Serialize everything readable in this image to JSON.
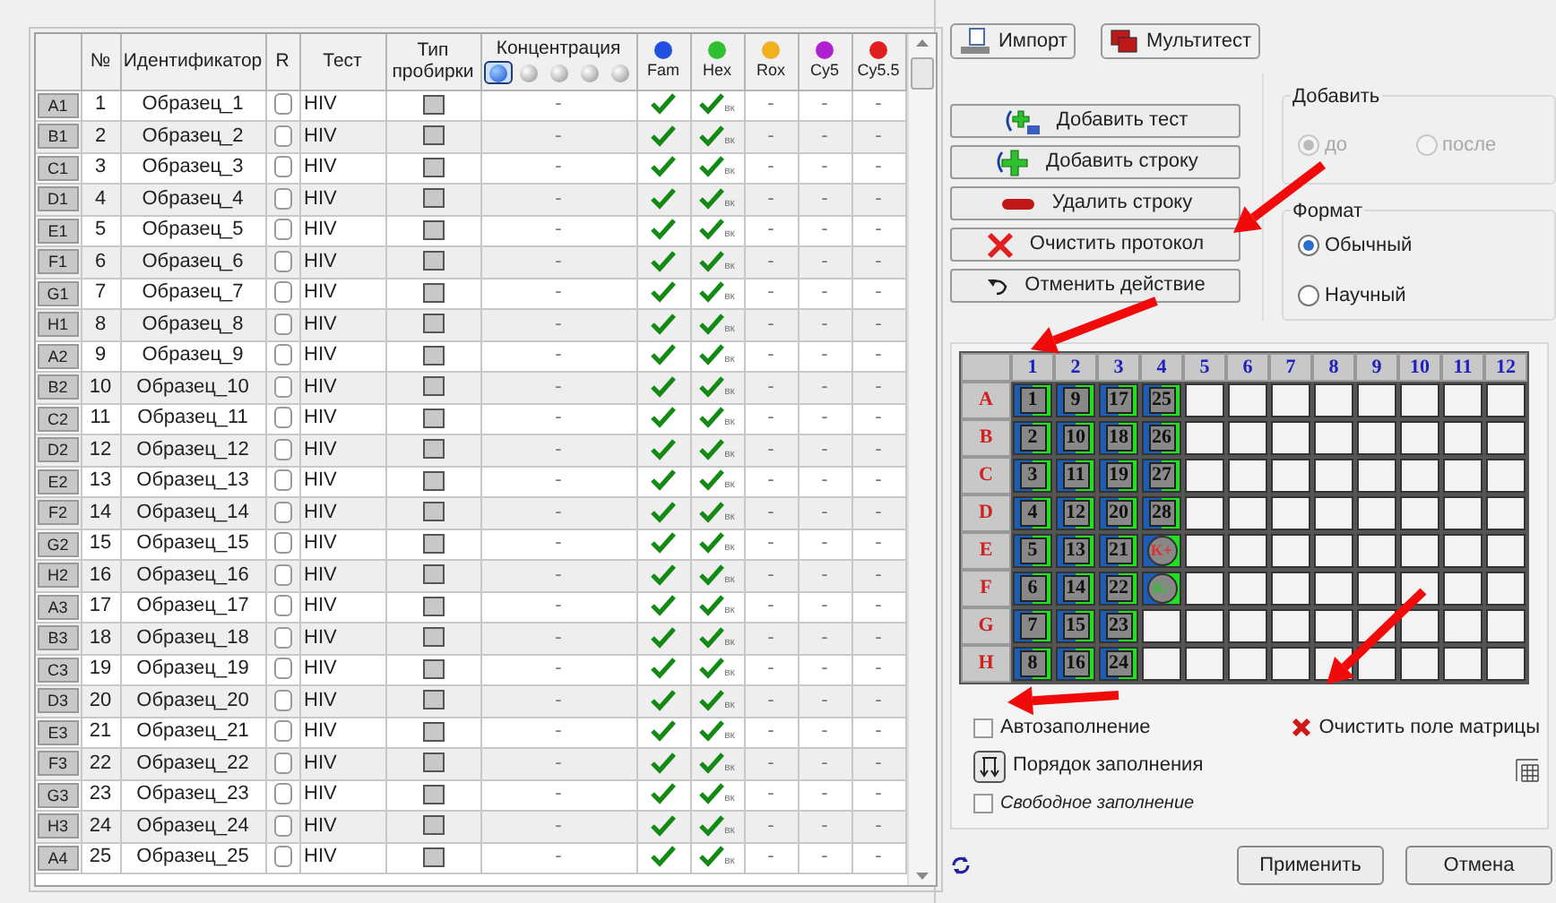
{
  "table": {
    "columns": [
      "№",
      "Идентификатор",
      "R",
      "Тест",
      "Тип пробирки",
      "Концентрация"
    ],
    "concentration_levels": [
      {
        "selected": true
      },
      {
        "selected": false
      },
      {
        "selected": false
      },
      {
        "selected": false
      },
      {
        "selected": false
      }
    ],
    "channels": [
      {
        "label": "Fam",
        "color": "#2050e0"
      },
      {
        "label": "Hex",
        "color": "#30c030"
      },
      {
        "label": "Rox",
        "color": "#f0b020"
      },
      {
        "label": "Cy5",
        "color": "#b020d0"
      },
      {
        "label": "Cy5.5",
        "color": "#e02020"
      }
    ],
    "rows": [
      {
        "well": "A1",
        "number": "1",
        "id": "Образец_1",
        "r": false,
        "test": "HIV",
        "conc": "-",
        "marks": [
          {
            "kind": "check"
          },
          {
            "kind": "check",
            "sub": "вк"
          },
          {
            "kind": "text",
            "text": "-"
          },
          {
            "kind": "text",
            "text": "-"
          },
          {
            "kind": "text",
            "text": "-"
          }
        ]
      },
      {
        "well": "B1",
        "number": "2",
        "id": "Образец_2",
        "r": false,
        "test": "HIV",
        "conc": "-",
        "marks": [
          {
            "kind": "check"
          },
          {
            "kind": "check",
            "sub": "вк"
          },
          {
            "kind": "text",
            "text": "-"
          },
          {
            "kind": "text",
            "text": "-"
          },
          {
            "kind": "text",
            "text": "-"
          }
        ]
      },
      {
        "well": "C1",
        "number": "3",
        "id": "Образец_3",
        "r": false,
        "test": "HIV",
        "conc": "-",
        "marks": [
          {
            "kind": "check"
          },
          {
            "kind": "check",
            "sub": "вк"
          },
          {
            "kind": "text",
            "text": "-"
          },
          {
            "kind": "text",
            "text": "-"
          },
          {
            "kind": "text",
            "text": "-"
          }
        ]
      },
      {
        "well": "D1",
        "number": "4",
        "id": "Образец_4",
        "r": false,
        "test": "HIV",
        "conc": "-",
        "marks": [
          {
            "kind": "check"
          },
          {
            "kind": "check",
            "sub": "вк"
          },
          {
            "kind": "text",
            "text": "-"
          },
          {
            "kind": "text",
            "text": "-"
          },
          {
            "kind": "text",
            "text": "-"
          }
        ]
      },
      {
        "well": "E1",
        "number": "5",
        "id": "Образец_5",
        "r": false,
        "test": "HIV",
        "conc": "-",
        "marks": [
          {
            "kind": "check"
          },
          {
            "kind": "check",
            "sub": "вк"
          },
          {
            "kind": "text",
            "text": "-"
          },
          {
            "kind": "text",
            "text": "-"
          },
          {
            "kind": "text",
            "text": "-"
          }
        ]
      },
      {
        "well": "F1",
        "number": "6",
        "id": "Образец_6",
        "r": false,
        "test": "HIV",
        "conc": "-",
        "marks": [
          {
            "kind": "check"
          },
          {
            "kind": "check",
            "sub": "вк"
          },
          {
            "kind": "text",
            "text": "-"
          },
          {
            "kind": "text",
            "text": "-"
          },
          {
            "kind": "text",
            "text": "-"
          }
        ]
      },
      {
        "well": "G1",
        "number": "7",
        "id": "Образец_7",
        "r": false,
        "test": "HIV",
        "conc": "-",
        "marks": [
          {
            "kind": "check"
          },
          {
            "kind": "check",
            "sub": "вк"
          },
          {
            "kind": "text",
            "text": "-"
          },
          {
            "kind": "text",
            "text": "-"
          },
          {
            "kind": "text",
            "text": "-"
          }
        ]
      },
      {
        "well": "H1",
        "number": "8",
        "id": "Образец_8",
        "r": false,
        "test": "HIV",
        "conc": "-",
        "marks": [
          {
            "kind": "check"
          },
          {
            "kind": "check",
            "sub": "вк"
          },
          {
            "kind": "text",
            "text": "-"
          },
          {
            "kind": "text",
            "text": "-"
          },
          {
            "kind": "text",
            "text": "-"
          }
        ]
      },
      {
        "well": "A2",
        "number": "9",
        "id": "Образец_9",
        "r": false,
        "test": "HIV",
        "conc": "-",
        "marks": [
          {
            "kind": "check"
          },
          {
            "kind": "check",
            "sub": "вк"
          },
          {
            "kind": "text",
            "text": "-"
          },
          {
            "kind": "text",
            "text": "-"
          },
          {
            "kind": "text",
            "text": "-"
          }
        ]
      },
      {
        "well": "B2",
        "number": "10",
        "id": "Образец_10",
        "r": false,
        "test": "HIV",
        "conc": "-",
        "marks": [
          {
            "kind": "check"
          },
          {
            "kind": "check",
            "sub": "вк"
          },
          {
            "kind": "text",
            "text": "-"
          },
          {
            "kind": "text",
            "text": "-"
          },
          {
            "kind": "text",
            "text": "-"
          }
        ]
      },
      {
        "well": "C2",
        "number": "11",
        "id": "Образец_11",
        "r": false,
        "test": "HIV",
        "conc": "-",
        "marks": [
          {
            "kind": "check"
          },
          {
            "kind": "check",
            "sub": "вк"
          },
          {
            "kind": "text",
            "text": "-"
          },
          {
            "kind": "text",
            "text": "-"
          },
          {
            "kind": "text",
            "text": "-"
          }
        ]
      },
      {
        "well": "D2",
        "number": "12",
        "id": "Образец_12",
        "r": false,
        "test": "HIV",
        "conc": "-",
        "marks": [
          {
            "kind": "check"
          },
          {
            "kind": "check",
            "sub": "вк"
          },
          {
            "kind": "text",
            "text": "-"
          },
          {
            "kind": "text",
            "text": "-"
          },
          {
            "kind": "text",
            "text": "-"
          }
        ]
      },
      {
        "well": "E2",
        "number": "13",
        "id": "Образец_13",
        "r": false,
        "test": "HIV",
        "conc": "-",
        "marks": [
          {
            "kind": "check"
          },
          {
            "kind": "check",
            "sub": "вк"
          },
          {
            "kind": "text",
            "text": "-"
          },
          {
            "kind": "text",
            "text": "-"
          },
          {
            "kind": "text",
            "text": "-"
          }
        ]
      },
      {
        "well": "F2",
        "number": "14",
        "id": "Образец_14",
        "r": false,
        "test": "HIV",
        "conc": "-",
        "marks": [
          {
            "kind": "check"
          },
          {
            "kind": "check",
            "sub": "вк"
          },
          {
            "kind": "text",
            "text": "-"
          },
          {
            "kind": "text",
            "text": "-"
          },
          {
            "kind": "text",
            "text": "-"
          }
        ]
      },
      {
        "well": "G2",
        "number": "15",
        "id": "Образец_15",
        "r": false,
        "test": "HIV",
        "conc": "-",
        "marks": [
          {
            "kind": "check"
          },
          {
            "kind": "check",
            "sub": "вк"
          },
          {
            "kind": "text",
            "text": "-"
          },
          {
            "kind": "text",
            "text": "-"
          },
          {
            "kind": "text",
            "text": "-"
          }
        ]
      },
      {
        "well": "H2",
        "number": "16",
        "id": "Образец_16",
        "r": false,
        "test": "HIV",
        "conc": "-",
        "marks": [
          {
            "kind": "check"
          },
          {
            "kind": "check",
            "sub": "вк"
          },
          {
            "kind": "text",
            "text": "-"
          },
          {
            "kind": "text",
            "text": "-"
          },
          {
            "kind": "text",
            "text": "-"
          }
        ]
      },
      {
        "well": "A3",
        "number": "17",
        "id": "Образец_17",
        "r": false,
        "test": "HIV",
        "conc": "-",
        "marks": [
          {
            "kind": "check"
          },
          {
            "kind": "check",
            "sub": "вк"
          },
          {
            "kind": "text",
            "text": "-"
          },
          {
            "kind": "text",
            "text": "-"
          },
          {
            "kind": "text",
            "text": "-"
          }
        ]
      },
      {
        "well": "B3",
        "number": "18",
        "id": "Образец_18",
        "r": false,
        "test": "HIV",
        "conc": "-",
        "marks": [
          {
            "kind": "check"
          },
          {
            "kind": "check",
            "sub": "вк"
          },
          {
            "kind": "text",
            "text": "-"
          },
          {
            "kind": "text",
            "text": "-"
          },
          {
            "kind": "text",
            "text": "-"
          }
        ]
      },
      {
        "well": "C3",
        "number": "19",
        "id": "Образец_19",
        "r": false,
        "test": "HIV",
        "conc": "-",
        "marks": [
          {
            "kind": "check"
          },
          {
            "kind": "check",
            "sub": "вк"
          },
          {
            "kind": "text",
            "text": "-"
          },
          {
            "kind": "text",
            "text": "-"
          },
          {
            "kind": "text",
            "text": "-"
          }
        ]
      },
      {
        "well": "D3",
        "number": "20",
        "id": "Образец_20",
        "r": false,
        "test": "HIV",
        "conc": "-",
        "marks": [
          {
            "kind": "check"
          },
          {
            "kind": "check",
            "sub": "вк"
          },
          {
            "kind": "text",
            "text": "-"
          },
          {
            "kind": "text",
            "text": "-"
          },
          {
            "kind": "text",
            "text": "-"
          }
        ]
      },
      {
        "well": "E3",
        "number": "21",
        "id": "Образец_21",
        "r": false,
        "test": "HIV",
        "conc": "-",
        "marks": [
          {
            "kind": "check"
          },
          {
            "kind": "check",
            "sub": "вк"
          },
          {
            "kind": "text",
            "text": "-"
          },
          {
            "kind": "text",
            "text": "-"
          },
          {
            "kind": "text",
            "text": "-"
          }
        ]
      },
      {
        "well": "F3",
        "number": "22",
        "id": "Образец_22",
        "r": false,
        "test": "HIV",
        "conc": "-",
        "marks": [
          {
            "kind": "check"
          },
          {
            "kind": "check",
            "sub": "вк"
          },
          {
            "kind": "text",
            "text": "-"
          },
          {
            "kind": "text",
            "text": "-"
          },
          {
            "kind": "text",
            "text": "-"
          }
        ]
      },
      {
        "well": "G3",
        "number": "23",
        "id": "Образец_23",
        "r": false,
        "test": "HIV",
        "conc": "-",
        "marks": [
          {
            "kind": "check"
          },
          {
            "kind": "check",
            "sub": "вк"
          },
          {
            "kind": "text",
            "text": "-"
          },
          {
            "kind": "text",
            "text": "-"
          },
          {
            "kind": "text",
            "text": "-"
          }
        ]
      },
      {
        "well": "H3",
        "number": "24",
        "id": "Образец_24",
        "r": false,
        "test": "HIV",
        "conc": "-",
        "marks": [
          {
            "kind": "check"
          },
          {
            "kind": "check",
            "sub": "вк"
          },
          {
            "kind": "text",
            "text": "-"
          },
          {
            "kind": "text",
            "text": "-"
          },
          {
            "kind": "text",
            "text": "-"
          }
        ]
      },
      {
        "well": "A4",
        "number": "25",
        "id": "Образец_25",
        "r": false,
        "test": "HIV",
        "conc": "-",
        "marks": [
          {
            "kind": "check"
          },
          {
            "kind": "check",
            "sub": "вк"
          },
          {
            "kind": "text",
            "text": "-"
          },
          {
            "kind": "text",
            "text": "-"
          },
          {
            "kind": "text",
            "text": "-"
          }
        ]
      }
    ]
  },
  "top_buttons": [
    "Импорт",
    "Мультитест"
  ],
  "actions": [
    {
      "label": "Добавить тест",
      "kind": "add-test"
    },
    {
      "label": "Добавить строку",
      "kind": "add-row"
    },
    {
      "label": "Удалить строку",
      "kind": "remove"
    },
    {
      "label": "Очистить протокол",
      "kind": "clear"
    },
    {
      "label": "Отменить действие",
      "kind": "undo"
    }
  ],
  "add_group": {
    "title": "Добавить",
    "options": [
      {
        "label": "до",
        "selected": true,
        "disabled": true
      },
      {
        "label": "после",
        "selected": false,
        "disabled": true
      }
    ]
  },
  "format_group": {
    "title": "Формат",
    "options": [
      {
        "label": "Обычный",
        "selected": true,
        "disabled": false
      },
      {
        "label": "Научный",
        "selected": false,
        "disabled": false
      }
    ]
  },
  "plate": {
    "columns": [
      "1",
      "2",
      "3",
      "4",
      "5",
      "6",
      "7",
      "8",
      "9",
      "10",
      "11",
      "12"
    ],
    "rows": [
      {
        "label": "A",
        "wells": [
          {
            "kind": "sample",
            "text": "1"
          },
          {
            "kind": "sample",
            "text": "9"
          },
          {
            "kind": "sample",
            "text": "17"
          },
          {
            "kind": "sample",
            "text": "25"
          }
        ]
      },
      {
        "label": "B",
        "wells": [
          {
            "kind": "sample",
            "text": "2"
          },
          {
            "kind": "sample",
            "text": "10"
          },
          {
            "kind": "sample",
            "text": "18"
          },
          {
            "kind": "sample",
            "text": "26"
          }
        ]
      },
      {
        "label": "C",
        "wells": [
          {
            "kind": "sample",
            "text": "3"
          },
          {
            "kind": "sample",
            "text": "11"
          },
          {
            "kind": "sample",
            "text": "19"
          },
          {
            "kind": "sample",
            "text": "27"
          }
        ]
      },
      {
        "label": "D",
        "wells": [
          {
            "kind": "sample",
            "text": "4"
          },
          {
            "kind": "sample",
            "text": "12"
          },
          {
            "kind": "sample",
            "text": "20"
          },
          {
            "kind": "sample",
            "text": "28"
          }
        ]
      },
      {
        "label": "E",
        "wells": [
          {
            "kind": "sample",
            "text": "5"
          },
          {
            "kind": "sample",
            "text": "13"
          },
          {
            "kind": "sample",
            "text": "21"
          },
          {
            "kind": "positive_control",
            "text": "K+"
          }
        ]
      },
      {
        "label": "F",
        "wells": [
          {
            "kind": "sample",
            "text": "6"
          },
          {
            "kind": "sample",
            "text": "14"
          },
          {
            "kind": "sample",
            "text": "22"
          },
          {
            "kind": "negative_control",
            "text": "K-"
          }
        ]
      },
      {
        "label": "G",
        "wells": [
          {
            "kind": "sample",
            "text": "7"
          },
          {
            "kind": "sample",
            "text": "15"
          },
          {
            "kind": "sample",
            "text": "23"
          }
        ]
      },
      {
        "label": "H",
        "wells": [
          {
            "kind": "sample",
            "text": "8"
          },
          {
            "kind": "sample",
            "text": "16"
          },
          {
            "kind": "sample",
            "text": "24"
          }
        ]
      }
    ]
  },
  "options": [
    {
      "kind": "checkbox",
      "label": "Автозаполнение",
      "checked": false
    },
    {
      "kind": "button",
      "label": "Порядок заполнения"
    },
    {
      "kind": "checkbox",
      "label": "Свободное заполнение",
      "checked": false,
      "italic": true
    }
  ],
  "clear_matrix": "Очистить поле матрицы",
  "bottom_buttons": [
    "Применить",
    "Отмена"
  ]
}
